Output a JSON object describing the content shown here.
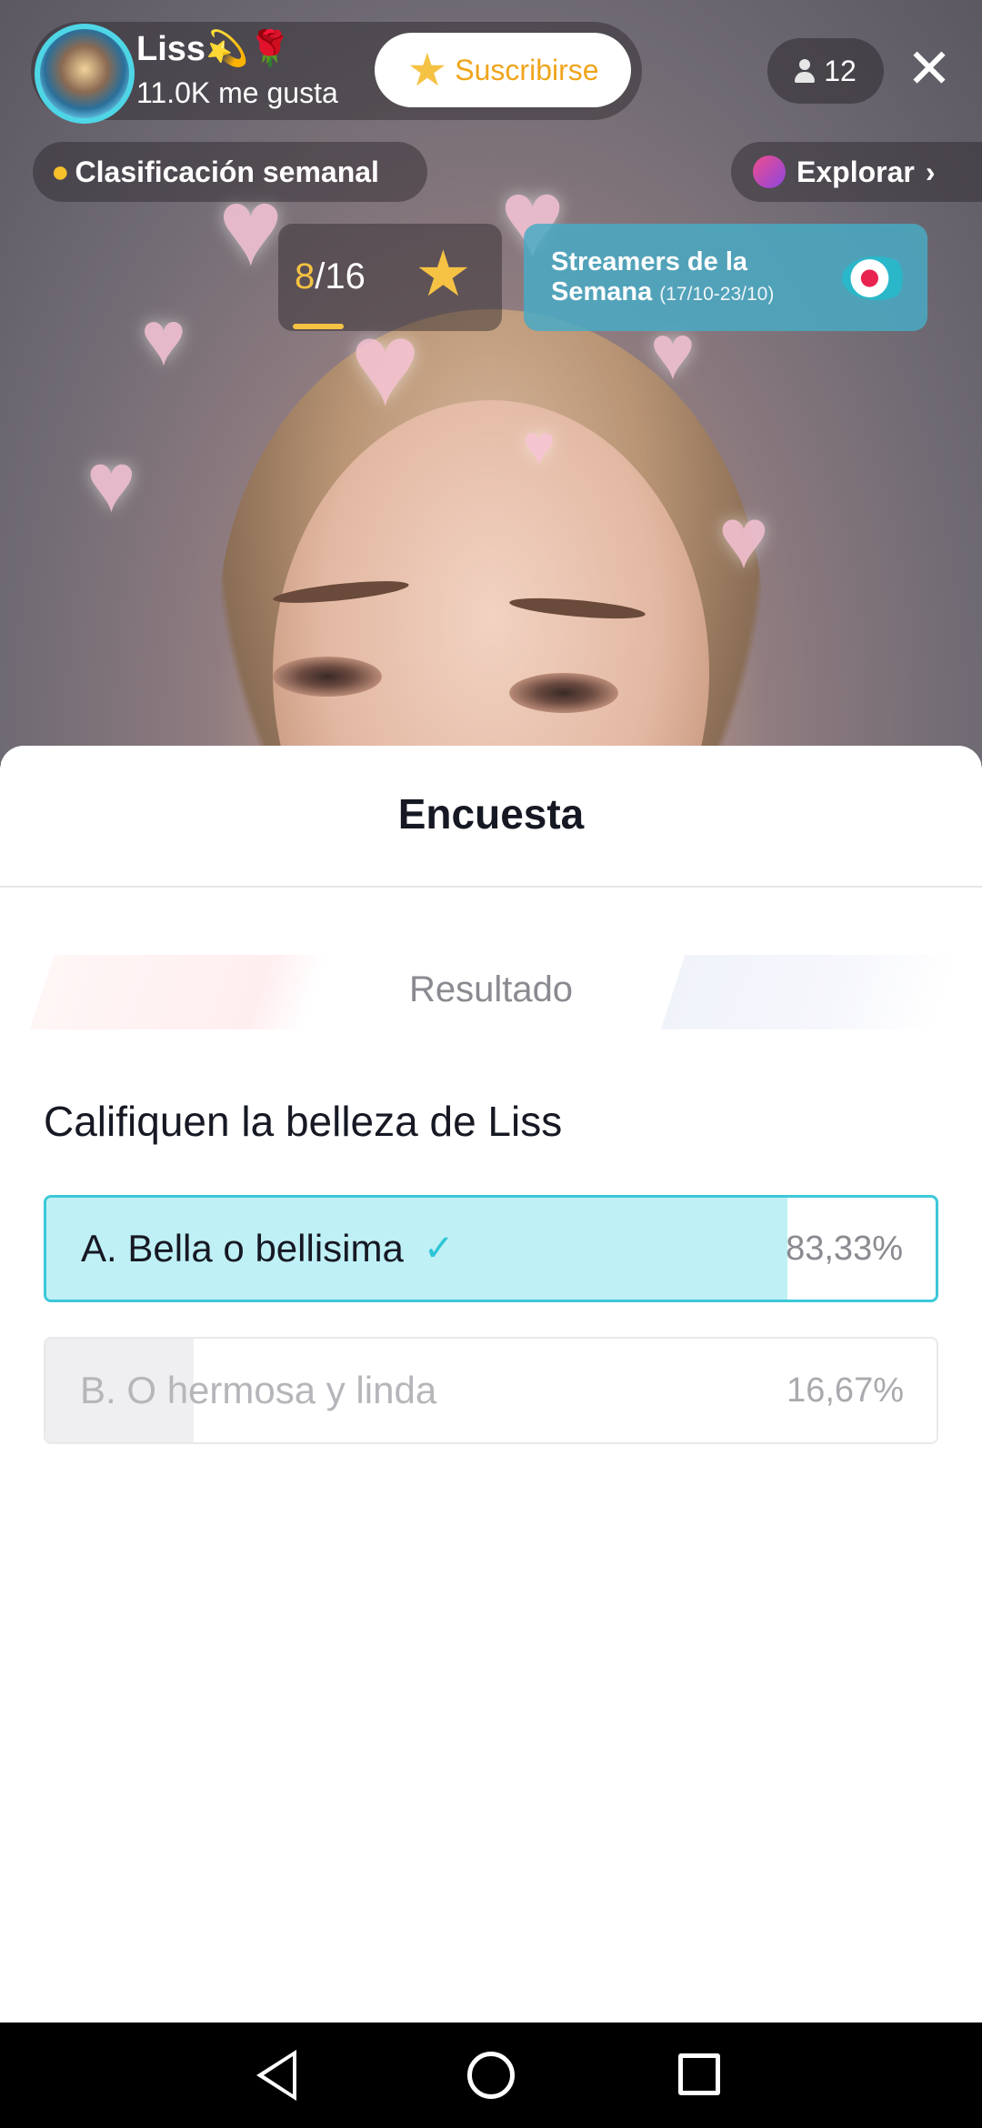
{
  "live": {
    "host_name": "Liss💫🌹",
    "host_likes": "11.0K me gusta",
    "subscribe_label": "Suscribirse",
    "viewer_count": "12",
    "close_icon": "close-icon",
    "weekly_rank_label": "Clasificación semanal",
    "explore_label": "Explorar",
    "progress_current": "8",
    "progress_total": "/16",
    "progress_fraction": 0.5,
    "streamers_title": "Streamers de la Semana",
    "streamers_dates": "(17/10-23/10)"
  },
  "poll": {
    "title": "Encuesta",
    "tab_label": "Resultado",
    "question": "Califiquen la belleza de Liss",
    "options": [
      {
        "label": "A. Bella o bellisima",
        "percent_text": "83,33%",
        "percent": 83.33,
        "selected": true,
        "accent": "#3cc8d8"
      },
      {
        "label": "B. O hermosa y linda",
        "percent_text": "16,67%",
        "percent": 16.67,
        "selected": false,
        "accent": "#efeff1"
      }
    ]
  },
  "navbar": {
    "back_icon": "back-triangle-icon",
    "home_icon": "home-circle-icon",
    "recents_icon": "recents-square-icon"
  },
  "colors": {
    "accent": "#3cc8d8",
    "gold": "#f5c244",
    "text_primary": "#161823",
    "text_secondary": "#8a8b91"
  }
}
